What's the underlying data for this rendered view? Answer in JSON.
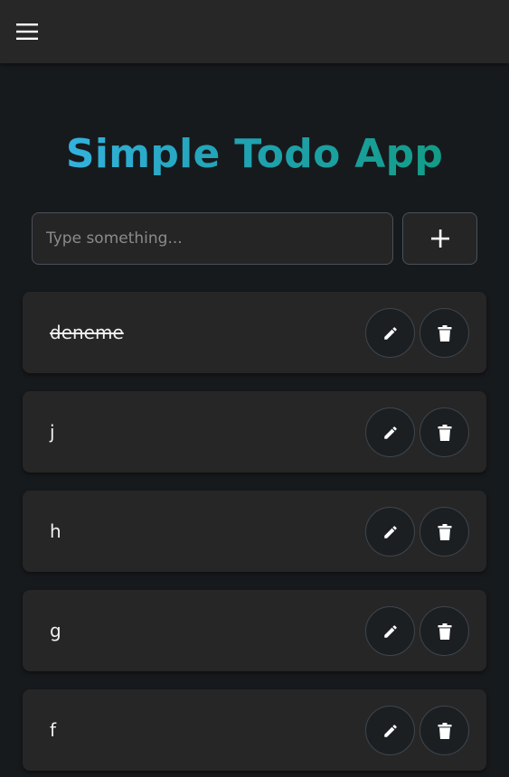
{
  "header": {
    "menu_icon": "hamburger-menu-icon"
  },
  "title": "Simple Todo App",
  "title_gradient": [
    "#3bb8ee",
    "#0e9a78"
  ],
  "new_todo": {
    "placeholder": "Type something...",
    "value": ""
  },
  "add_button": {
    "icon": "plus-icon"
  },
  "todos": [
    {
      "text": "deneme",
      "completed": true
    },
    {
      "text": "j",
      "completed": false
    },
    {
      "text": "h",
      "completed": false
    },
    {
      "text": "g",
      "completed": false
    },
    {
      "text": "f",
      "completed": false
    }
  ],
  "item_actions": {
    "edit_icon": "pencil-icon",
    "delete_icon": "trash-icon"
  }
}
